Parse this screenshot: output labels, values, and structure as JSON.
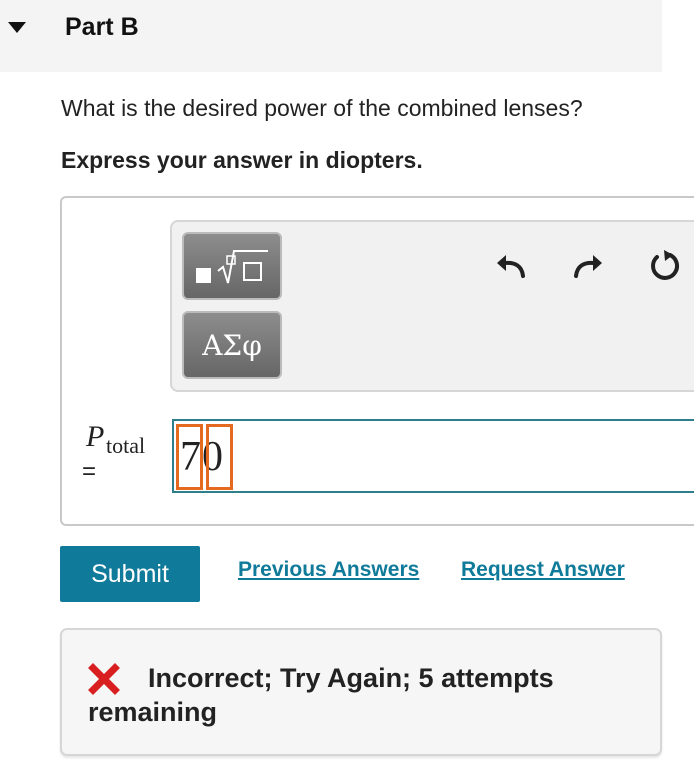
{
  "part": {
    "title": "Part B",
    "toggle_icon": "caret-down-icon"
  },
  "question": "What is the desired power of the combined lenses?",
  "instruction": "Express your answer in diopters.",
  "toolbar": {
    "templates_icon": "templates-sqrt-icon",
    "greek_label": "ΑΣφ",
    "undo_icon": "undo-icon",
    "redo_icon": "redo-icon",
    "reset_icon": "reset-icon"
  },
  "answer": {
    "variable": "P",
    "subscript": "total",
    "equals": "=",
    "value": "70"
  },
  "actions": {
    "submit": "Submit",
    "previous": "Previous Answers",
    "request": "Request Answer"
  },
  "feedback": {
    "icon": "incorrect-x-icon",
    "text": "Incorrect; Try Again; 5 attempts remaining"
  },
  "colors": {
    "accent": "#0f7a99",
    "input_border": "#2e7e8c",
    "cursor": "#e46a1f",
    "error": "#d81e1e"
  }
}
